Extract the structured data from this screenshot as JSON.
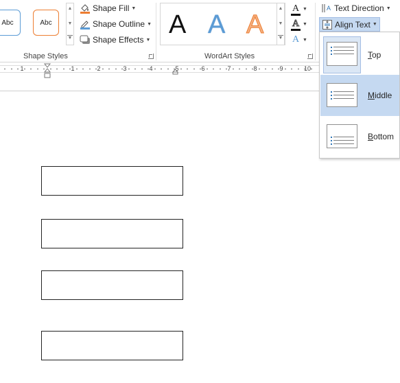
{
  "ribbon": {
    "shape_styles": {
      "group_label": "Shape Styles",
      "gallery": [
        "Abc",
        "Abc"
      ],
      "commands": {
        "fill": "Shape Fill",
        "outline": "Shape Outline",
        "effects": "Shape Effects"
      }
    },
    "wordart_styles": {
      "group_label": "WordArt Styles",
      "gallery": [
        "A",
        "A",
        "A"
      ],
      "text_fill_icon": "A",
      "text_outline_icon": "A",
      "text_effects_icon": "A"
    },
    "text": {
      "text_direction": "Text Direction",
      "align_text": "Align Text"
    }
  },
  "ruler": {
    "numbers": [
      "1",
      "1",
      "2",
      "3",
      "4",
      "5",
      "6",
      "7",
      "8",
      "9",
      "10"
    ]
  },
  "align_menu": {
    "items": [
      {
        "label": "Top",
        "mnemonic": "T",
        "rest": "op"
      },
      {
        "label": "Middle",
        "mnemonic": "M",
        "rest": "iddle"
      },
      {
        "label": "Bottom",
        "mnemonic": "B",
        "rest": "ottom"
      }
    ]
  },
  "colors": {
    "accent_blue": "#5b9bd5",
    "accent_orange": "#ed7d31",
    "hover_blue": "#c5d9f1"
  }
}
